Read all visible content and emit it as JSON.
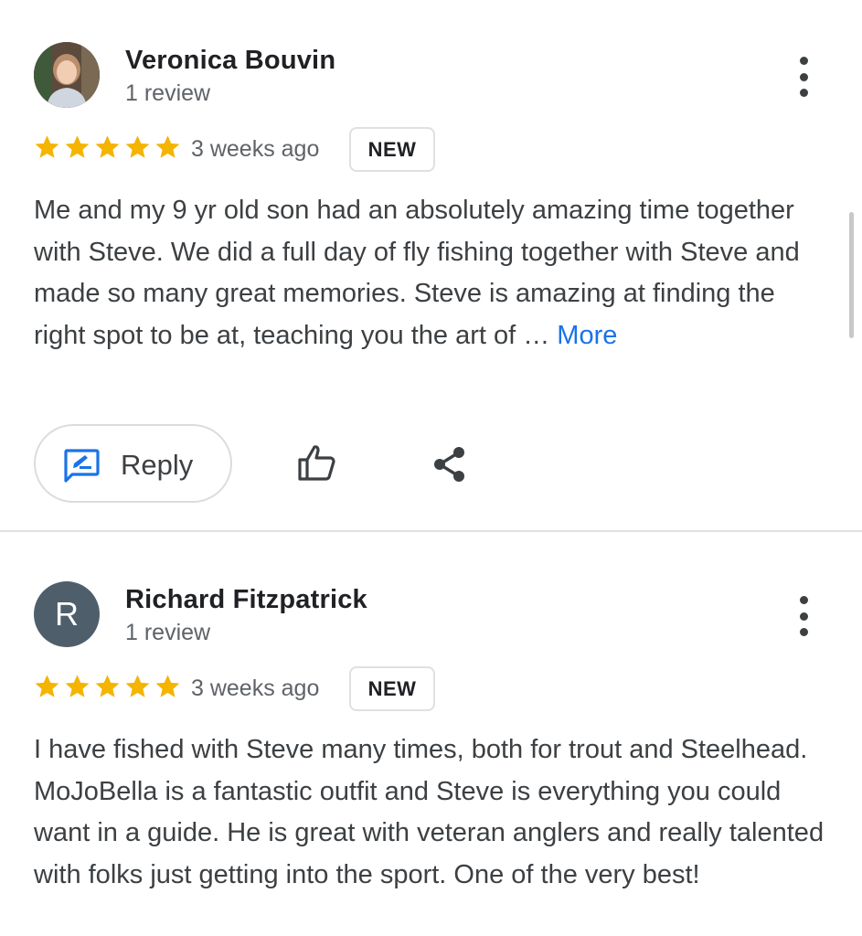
{
  "reviews": [
    {
      "author": "Veronica Bouvin",
      "review_count": "1 review",
      "avatar": {
        "type": "photo"
      },
      "rating": 5,
      "time": "3 weeks ago",
      "badge": "NEW",
      "text": "Me and my 9 yr old son had an absolutely amazing time together with Steve. We did a full day of fly fishing together with Steve and made so many great memories. Steve is amazing at finding the right spot to be at, teaching you the art of … ",
      "more_label": "More",
      "actions": {
        "reply_label": "Reply"
      }
    },
    {
      "author": "Richard Fitzpatrick",
      "review_count": "1 review",
      "avatar": {
        "type": "letter",
        "letter": "R"
      },
      "rating": 5,
      "time": "3 weeks ago",
      "badge": "NEW",
      "text": "I have fished with Steve many times, both for trout and Steelhead. MoJoBella is a fantastic outfit and Steve is everything you could want in a guide. He is great with veteran anglers and really talented with folks just getting into the sport. One of the very best!"
    }
  ],
  "colors": {
    "star": "#f4b400",
    "link": "#1a73e8",
    "reply_icon": "#1a73e8",
    "letter_avatar": "#4f5e6b"
  },
  "icons": [
    "more-vert-icon",
    "star-icon",
    "rate-review-icon",
    "thumb-up-icon",
    "share-icon"
  ]
}
